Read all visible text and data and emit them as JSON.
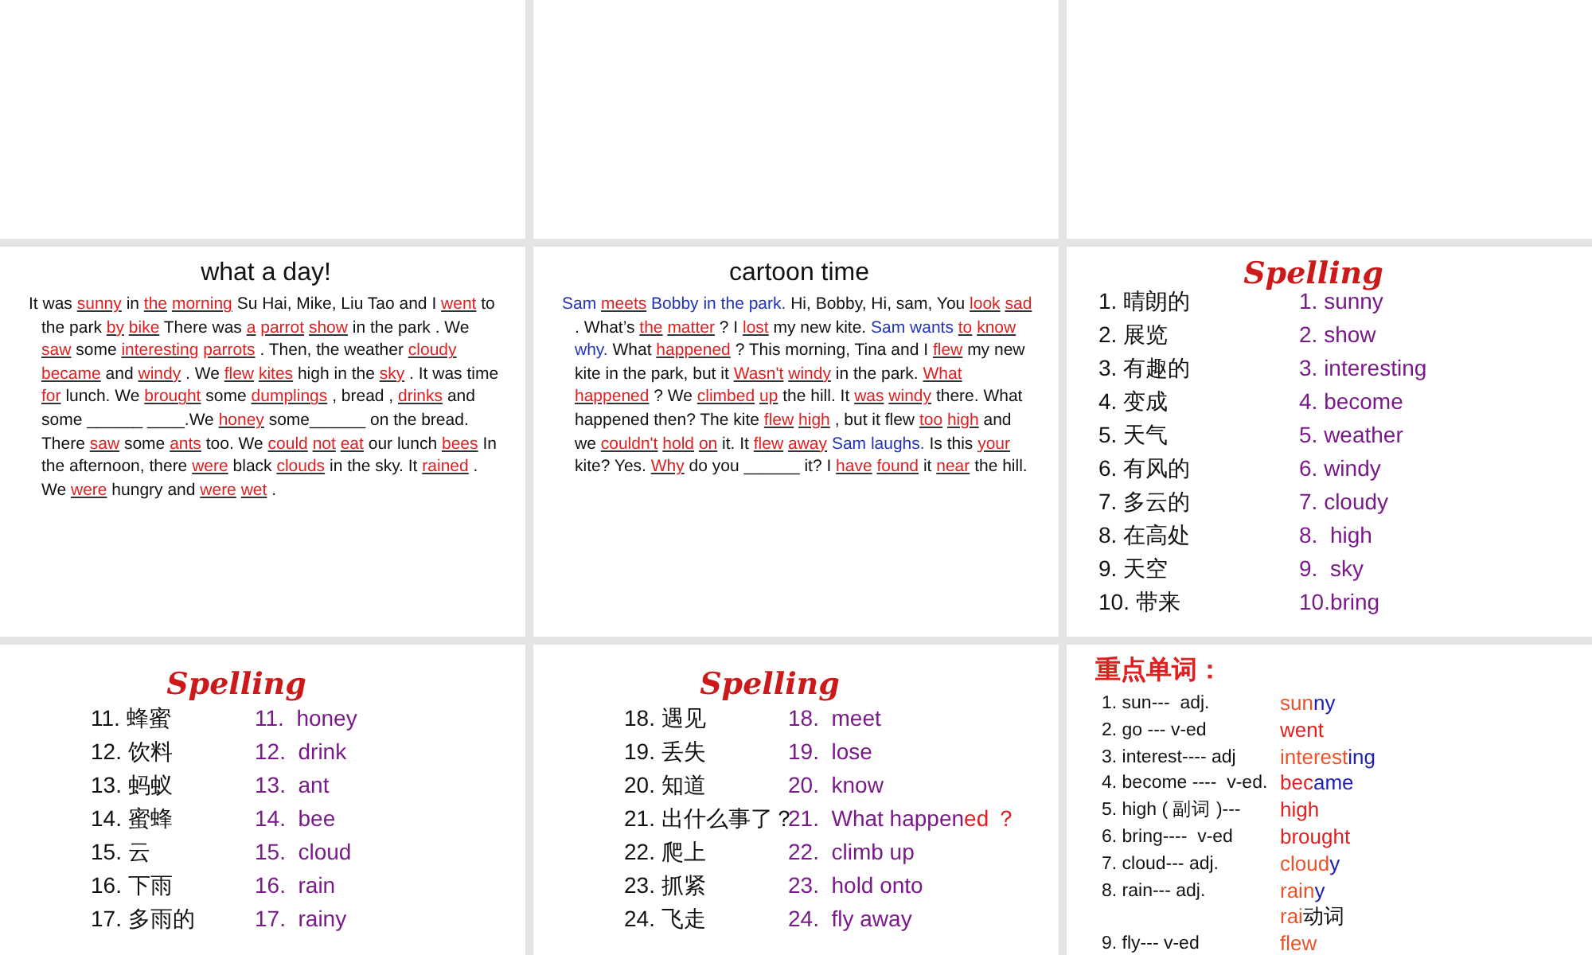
{
  "slides": [
    {
      "kind": "blank"
    },
    {
      "kind": "blank"
    },
    {
      "kind": "blank"
    },
    {
      "kind": "passage",
      "title": "what a day!",
      "segments": [
        {
          "kind": "text",
          "text": "It was"
        },
        {
          "kind": "answer",
          "text": "sunny"
        },
        {
          "kind": "text",
          "text": "in"
        },
        {
          "kind": "answer",
          "text": "the"
        },
        {
          "kind": "answer",
          "text": "morning"
        },
        {
          "kind": "text",
          "text": "Su Hai, Mike, Liu Tao and I"
        },
        {
          "kind": "answer",
          "text": "went"
        },
        {
          "kind": "text",
          "text": "to the park"
        },
        {
          "kind": "answer",
          "text": "by"
        },
        {
          "kind": "answer",
          "text": "bike"
        },
        {
          "kind": "text",
          "text": "There was"
        },
        {
          "kind": "answer",
          "text": "a"
        },
        {
          "kind": "answer",
          "text": "parrot"
        },
        {
          "kind": "answer",
          "text": "show"
        },
        {
          "kind": "text",
          "text": "in the park . We"
        },
        {
          "kind": "answer",
          "text": "saw"
        },
        {
          "kind": "text",
          "text": "some"
        },
        {
          "kind": "answer",
          "text": "interesting"
        },
        {
          "kind": "answer",
          "text": "parrots"
        },
        {
          "kind": "text",
          "text": ". Then, the weather"
        },
        {
          "kind": "answer",
          "text": "cloudy"
        },
        {
          "kind": "answer",
          "text": "became"
        },
        {
          "kind": "text",
          "text": "and"
        },
        {
          "kind": "answer",
          "text": "windy"
        },
        {
          "kind": "text",
          "text": ". We"
        },
        {
          "kind": "answer",
          "text": "flew"
        },
        {
          "kind": "answer",
          "text": "kites"
        },
        {
          "kind": "text",
          "text": "high in the"
        },
        {
          "kind": "answer",
          "text": "sky"
        },
        {
          "kind": "text",
          "text": ". It was time"
        },
        {
          "kind": "answer",
          "text": "for"
        },
        {
          "kind": "text",
          "text": "lunch. We"
        },
        {
          "kind": "answer",
          "text": "brought"
        },
        {
          "kind": "text",
          "text": "some"
        },
        {
          "kind": "answer",
          "text": "dumplings"
        },
        {
          "kind": "text",
          "text": ", bread ,"
        },
        {
          "kind": "answer",
          "text": "drinks"
        },
        {
          "kind": "text",
          "text": "and some ______ ____.We"
        },
        {
          "kind": "answer",
          "text": "honey"
        },
        {
          "kind": "text",
          "text": "some______ on the bread. There"
        },
        {
          "kind": "answer",
          "text": "saw"
        },
        {
          "kind": "text",
          "text": "some"
        },
        {
          "kind": "answer",
          "text": "ants"
        },
        {
          "kind": "text",
          "text": "too. We"
        },
        {
          "kind": "answer",
          "text": "could"
        },
        {
          "kind": "answer",
          "text": "not"
        },
        {
          "kind": "answer",
          "text": "eat"
        },
        {
          "kind": "text",
          "text": "our lunch"
        },
        {
          "kind": "answer",
          "text": "bees"
        },
        {
          "kind": "text",
          "text": "In the afternoon, there"
        },
        {
          "kind": "answer",
          "text": "were"
        },
        {
          "kind": "text",
          "text": "black"
        },
        {
          "kind": "answer",
          "text": "clouds"
        },
        {
          "kind": "text",
          "text": "in the sky. It"
        },
        {
          "kind": "answer",
          "text": "rained"
        },
        {
          "kind": "text",
          "text": ". We"
        },
        {
          "kind": "answer",
          "text": "were"
        },
        {
          "kind": "text",
          "text": "hungry and"
        },
        {
          "kind": "answer",
          "text": "were"
        },
        {
          "kind": "answer",
          "text": "wet"
        },
        {
          "kind": "text",
          "text": "."
        }
      ]
    },
    {
      "kind": "passage",
      "title": "cartoon time",
      "segments": [
        {
          "kind": "name",
          "text": "Sam"
        },
        {
          "kind": "answer",
          "text": "meets"
        },
        {
          "kind": "name",
          "text": "Bobby in the park."
        },
        {
          "kind": "text",
          "text": "Hi, Bobby, Hi, sam, You"
        },
        {
          "kind": "answer",
          "text": "look"
        },
        {
          "kind": "answer",
          "text": "sad"
        },
        {
          "kind": "text",
          "text": ". What’s"
        },
        {
          "kind": "answer",
          "text": "the"
        },
        {
          "kind": "answer",
          "text": "matter"
        },
        {
          "kind": "text",
          "text": "? I"
        },
        {
          "kind": "answer",
          "text": "lost"
        },
        {
          "kind": "text",
          "text": "my new kite."
        },
        {
          "kind": "name",
          "text": "Sam wants"
        },
        {
          "kind": "answer",
          "text": "to"
        },
        {
          "kind": "answer",
          "text": "know"
        },
        {
          "kind": "name",
          "text": "why."
        },
        {
          "kind": "text",
          "text": "What"
        },
        {
          "kind": "answer",
          "text": "happened"
        },
        {
          "kind": "text",
          "text": "? This morning, Tina and I"
        },
        {
          "kind": "answer",
          "text": "flew"
        },
        {
          "kind": "text",
          "text": "my new kite in the park, but it"
        },
        {
          "kind": "answer",
          "text": "Wasn't"
        },
        {
          "kind": "answer",
          "text": "windy"
        },
        {
          "kind": "text",
          "text": "in the park."
        },
        {
          "kind": "answer",
          "text": "What"
        },
        {
          "kind": "answer",
          "text": "happened"
        },
        {
          "kind": "text",
          "text": "? We"
        },
        {
          "kind": "answer",
          "text": "climbed"
        },
        {
          "kind": "answer",
          "text": "up"
        },
        {
          "kind": "text",
          "text": "the hill. It"
        },
        {
          "kind": "answer",
          "text": "was"
        },
        {
          "kind": "answer",
          "text": "windy"
        },
        {
          "kind": "text",
          "text": "there. What happened then? The kite"
        },
        {
          "kind": "answer",
          "text": "flew"
        },
        {
          "kind": "answer",
          "text": "high"
        },
        {
          "kind": "text",
          "text": ", but it flew"
        },
        {
          "kind": "answer",
          "text": "too"
        },
        {
          "kind": "answer",
          "text": "high"
        },
        {
          "kind": "text",
          "text": "and we"
        },
        {
          "kind": "answer",
          "text": "couldn't"
        },
        {
          "kind": "answer",
          "text": "hold"
        },
        {
          "kind": "answer",
          "text": "on"
        },
        {
          "kind": "text",
          "text": "it. It"
        },
        {
          "kind": "answer",
          "text": "flew"
        },
        {
          "kind": "answer",
          "text": "away"
        },
        {
          "kind": "name",
          "text": "Sam laughs."
        },
        {
          "kind": "text",
          "text": "Is this"
        },
        {
          "kind": "answer",
          "text": "your"
        },
        {
          "kind": "text",
          "text": "kite? Yes."
        },
        {
          "kind": "answer",
          "text": "Why"
        },
        {
          "kind": "text",
          "text": "do you ______ it? I"
        },
        {
          "kind": "answer",
          "text": "have"
        },
        {
          "kind": "answer",
          "text": "found"
        },
        {
          "kind": "text",
          "text": "it"
        },
        {
          "kind": "answer",
          "text": "near"
        },
        {
          "kind": "text",
          "text": "the hill."
        }
      ]
    },
    {
      "kind": "spelling",
      "title": "Spelling",
      "rows": [
        {
          "term": "1. 晴朗的",
          "answer": "1. sunny"
        },
        {
          "term": "2. 展览",
          "answer": "2. show"
        },
        {
          "term": "3. 有趣的",
          "answer": "3. interesting"
        },
        {
          "term": "4. 变成",
          "answer": "4. become"
        },
        {
          "term": "5. 天气",
          "answer": "5. weather"
        },
        {
          "term": "6. 有风的",
          "answer": "6. windy"
        },
        {
          "term": "7. 多云的",
          "answer": "7. cloudy"
        },
        {
          "term": "8. 在高处",
          "answer": "8.  high"
        },
        {
          "term": "9. 天空",
          "answer": "9.  sky"
        },
        {
          "term": "10. 带来",
          "answer": "10.bring"
        }
      ]
    },
    {
      "kind": "spelling",
      "title": "Spelling",
      "rows": [
        {
          "term": "11. 蜂蜜",
          "answer": "11.  honey"
        },
        {
          "term": "12. 饮料",
          "answer": "12.  drink"
        },
        {
          "term": "13. 蚂蚁",
          "answer": "13.  ant"
        },
        {
          "term": "14. 蜜蜂",
          "answer": "14.  bee"
        },
        {
          "term": "15. 云",
          "answer": "15.  cloud"
        },
        {
          "term": "16. 下雨",
          "answer": "16.  rain"
        },
        {
          "term": "17. 多雨的",
          "answer": "17.  rainy"
        }
      ]
    },
    {
      "kind": "spelling",
      "title": "Spelling",
      "rows": [
        {
          "term": "18. 遇见",
          "answer": "18.  meet"
        },
        {
          "term": "19. 丢失",
          "answer": "19.  lose"
        },
        {
          "term": "20. 知道",
          "answer": "20.  know"
        },
        {
          "term": "21. 出什么事了？",
          "parts": [
            {
              "text": "21.  What happen",
              "color": "#7a1a8a"
            },
            {
              "text": "ed ？",
              "color": "#e02020"
            }
          ]
        },
        {
          "term": "22. 爬上",
          "answer": "22.  climb up"
        },
        {
          "term": "23. 抓紧",
          "answer": "23.  hold onto"
        },
        {
          "term": "24. 飞走",
          "answer": "24.  fly away"
        }
      ]
    },
    {
      "kind": "keywords",
      "title": "重点单词：",
      "rows": [
        {
          "rule": "1. sun---  adj.",
          "answer": [
            {
              "text": "sun",
              "color": "#e8542a"
            },
            {
              "text": "ny",
              "color": "#2020b0"
            }
          ]
        },
        {
          "rule": "2. go --- v-ed",
          "answer": [
            {
              "text": "went",
              "color": "#e02020"
            }
          ]
        },
        {
          "rule": "3. interest---- adj",
          "answer": [
            {
              "text": "interest",
              "color": "#e8542a"
            },
            {
              "text": "ing",
              "color": "#2020b0"
            }
          ]
        },
        {
          "rule": "4. become ----  v-ed.",
          "answer": [
            {
              "text": "bec",
              "color": "#e02020"
            },
            {
              "text": "ame",
              "color": "#2020b0"
            }
          ]
        },
        {
          "rule": "5. high ( 副词 )---",
          "answer": [
            {
              "text": "high",
              "color": "#e02020"
            }
          ]
        },
        {
          "rule": "6. bring----  v-ed",
          "answer": [
            {
              "text": "brought",
              "color": "#e02020"
            }
          ]
        },
        {
          "rule": "7. cloud--- adj.",
          "answer": [
            {
              "text": "cloud",
              "color": "#e8542a"
            },
            {
              "text": "y",
              "color": "#2020b0"
            }
          ]
        },
        {
          "rule": "8. rain--- adj.",
          "answer": [
            {
              "text": "rain",
              "color": "#e8542a"
            },
            {
              "text": "y",
              "color": "#2020b0"
            }
          ]
        },
        {
          "answer": [
            {
              "text": "rai",
              "color": "#e8542a"
            },
            {
              "text": "动词",
              "color": "#111111"
            }
          ]
        },
        {
          "rule": "9. fly--- v-ed",
          "answer": [
            {
              "text": "flew",
              "color": "#e8542a"
            }
          ]
        }
      ]
    }
  ]
}
